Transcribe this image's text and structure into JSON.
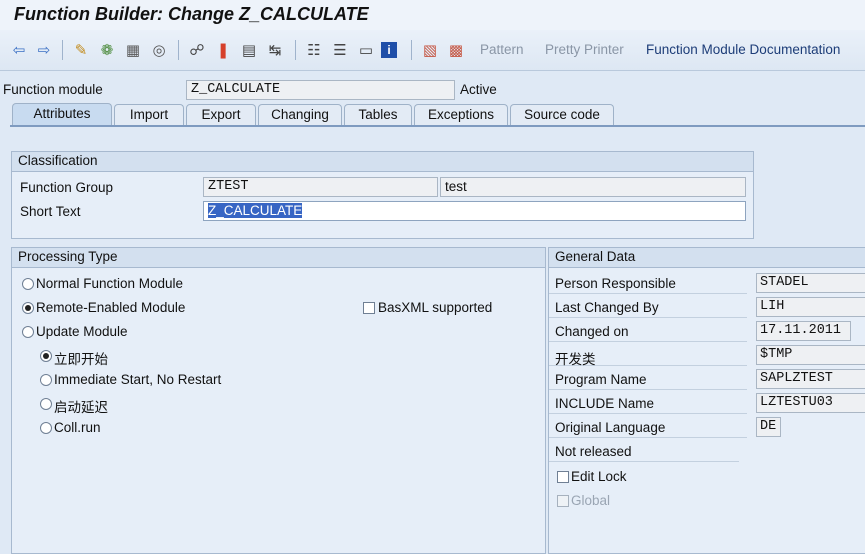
{
  "window": {
    "title": "Function Builder: Change Z_CALCULATE"
  },
  "toolbar": {
    "icons": [
      "back-icon",
      "forward-icon",
      "display-change-icon",
      "other-object-icon",
      "check-icon",
      "activate-icon",
      "where-used-icon",
      "navigate-icon",
      "object-list-icon",
      "display-navigation-icon",
      "test-icon",
      "object-tree-icon",
      "fullscreen-icon",
      "info-icon",
      "cut-icon",
      "copy-icon"
    ],
    "pattern_label": "Pattern",
    "pretty_printer_label": "Pretty Printer",
    "documentation_label": "Function Module Documentation"
  },
  "header": {
    "function_module_label": "Function module",
    "function_module_value": "Z_CALCULATE",
    "status": "Active"
  },
  "tabs": [
    "Attributes",
    "Import",
    "Export",
    "Changing",
    "Tables",
    "Exceptions",
    "Source code"
  ],
  "active_tab": "Attributes",
  "classification": {
    "title": "Classification",
    "function_group_label": "Function Group",
    "function_group_value": "ZTEST",
    "function_group_text": "test",
    "short_text_label": "Short Text",
    "short_text_value": "Z_CALCULATE"
  },
  "processing_type": {
    "title": "Processing Type",
    "options": [
      "Normal Function Module",
      "Remote-Enabled Module",
      "Update Module"
    ],
    "selected": "Remote-Enabled Module",
    "basxml_label": "BasXML supported",
    "update_options": [
      "立即开始",
      "Immediate Start, No Restart",
      "启动延迟",
      "Coll.run"
    ],
    "update_selected": "立即开始"
  },
  "general_data": {
    "title": "General Data",
    "rows": [
      {
        "label": "Person Responsible",
        "value": "STADEL"
      },
      {
        "label": "Last Changed By",
        "value": "LIH"
      },
      {
        "label": "Changed on",
        "value": "17.11.2011"
      },
      {
        "label": "开发类",
        "value": "$TMP"
      },
      {
        "label": "Program Name",
        "value": "SAPLZTEST"
      },
      {
        "label": "INCLUDE Name",
        "value": "LZTESTU03"
      },
      {
        "label": "Original Language",
        "value": "DE"
      }
    ],
    "release_status": "Not released",
    "edit_lock_label": "Edit Lock",
    "global_label": "Global"
  },
  "colors": {
    "accent": "#1d3d78",
    "selection": "#3765c4",
    "background": "#dfe9f5"
  }
}
